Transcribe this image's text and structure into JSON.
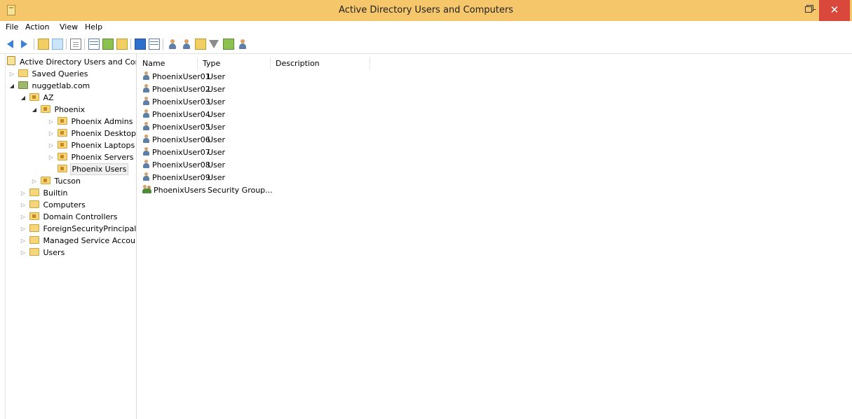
{
  "window": {
    "title": "Active Directory Users and Computers"
  },
  "menu": [
    "File",
    "Action",
    "View",
    "Help"
  ],
  "toolbar_icons": [
    "back-arrow-icon",
    "forward-arrow-icon",
    "up-folder-icon",
    "show-console-tree-icon",
    "properties-icon",
    "export-list-icon",
    "refresh-icon",
    "export-icon",
    "help-icon",
    "view-icon",
    "new-user-icon",
    "new-group-icon",
    "new-ou-icon",
    "filter-icon",
    "add-to-group-icon",
    "find-icon"
  ],
  "tree": {
    "root": "Active Directory Users and Com",
    "saved_queries": "Saved Queries",
    "domain": "nuggetlab.com",
    "az": "AZ",
    "phoenix": "Phoenix",
    "phoenix_admins": "Phoenix Admins",
    "phoenix_desktops": "Phoenix Desktops",
    "phoenix_laptops": "Phoenix Laptops",
    "phoenix_servers": "Phoenix Servers",
    "phoenix_users": "Phoenix Users",
    "tucson": "Tucson",
    "builtin": "Builtin",
    "computers": "Computers",
    "domain_controllers": "Domain Controllers",
    "foreign": "ForeignSecurityPrincipals",
    "managed": "Managed Service Accour",
    "users": "Users"
  },
  "list": {
    "columns": {
      "name": "Name",
      "type": "Type",
      "description": "Description"
    },
    "rows": [
      {
        "name": "PhoenixUser01",
        "type": "User"
      },
      {
        "name": "PhoenixUser02",
        "type": "User"
      },
      {
        "name": "PhoenixUser03",
        "type": "User"
      },
      {
        "name": "PhoenixUser04",
        "type": "User"
      },
      {
        "name": "PhoenixUser05",
        "type": "User"
      },
      {
        "name": "PhoenixUser06",
        "type": "User"
      },
      {
        "name": "PhoenixUser07",
        "type": "User"
      },
      {
        "name": "PhoenixUser08",
        "type": "User"
      },
      {
        "name": "PhoenixUser09",
        "type": "User"
      },
      {
        "name": "PhoenixUsers",
        "type": "Security Group..."
      }
    ]
  },
  "colors": {
    "titlebar": "#f5c66a",
    "close": "#d9483a"
  }
}
